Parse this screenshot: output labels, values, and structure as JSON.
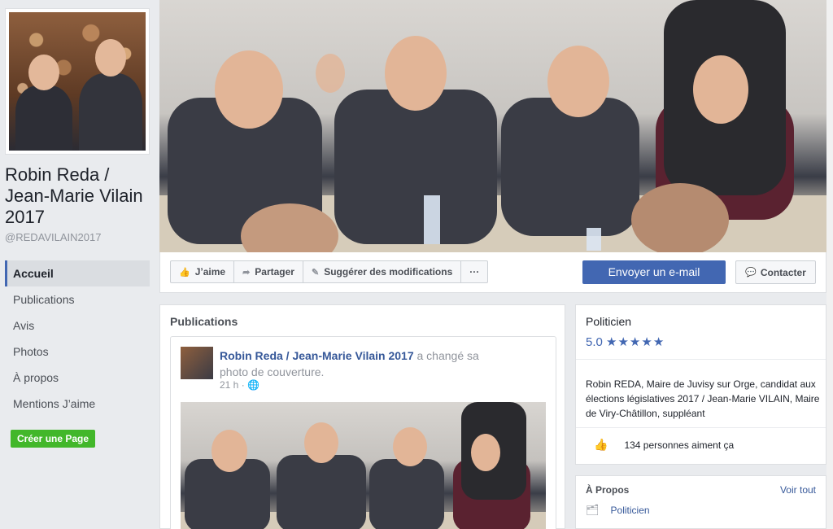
{
  "page": {
    "name": "Robin Reda / Jean-Marie Vilain 2017",
    "handle": "@REDAVILAIN2017"
  },
  "sidebar": {
    "items": [
      {
        "label": "Accueil"
      },
      {
        "label": "Publications"
      },
      {
        "label": "Avis"
      },
      {
        "label": "Photos"
      },
      {
        "label": "À propos"
      },
      {
        "label": "Mentions J’aime"
      }
    ],
    "create_page": "Créer une Page"
  },
  "actions": {
    "like": "J’aime",
    "share": "Partager",
    "suggest": "Suggérer des modifications",
    "more": "···",
    "email": "Envoyer un e-mail",
    "contact": "Contacter"
  },
  "publications": {
    "title": "Publications",
    "post": {
      "author": "Robin Reda / Jean-Marie Vilain 2017",
      "action": " a changé sa photo de couverture.",
      "time": "21 h · "
    }
  },
  "info": {
    "category": "Politicien",
    "rating_value": "5.0",
    "rating_stars": "★★★★★",
    "description": "Robin REDA, Maire de Juvisy sur Orge, candidat aux élections législatives 2017 / Jean-Marie VILAIN, Maire de Viry-Châtillon, suppléant",
    "likes": "134 personnes aiment ça"
  },
  "about": {
    "title": "À Propos",
    "see_all": "Voir tout",
    "category": "Politicien"
  },
  "colors": {
    "brand": "#4267b2",
    "link": "#365899",
    "create": "#42b72a"
  }
}
